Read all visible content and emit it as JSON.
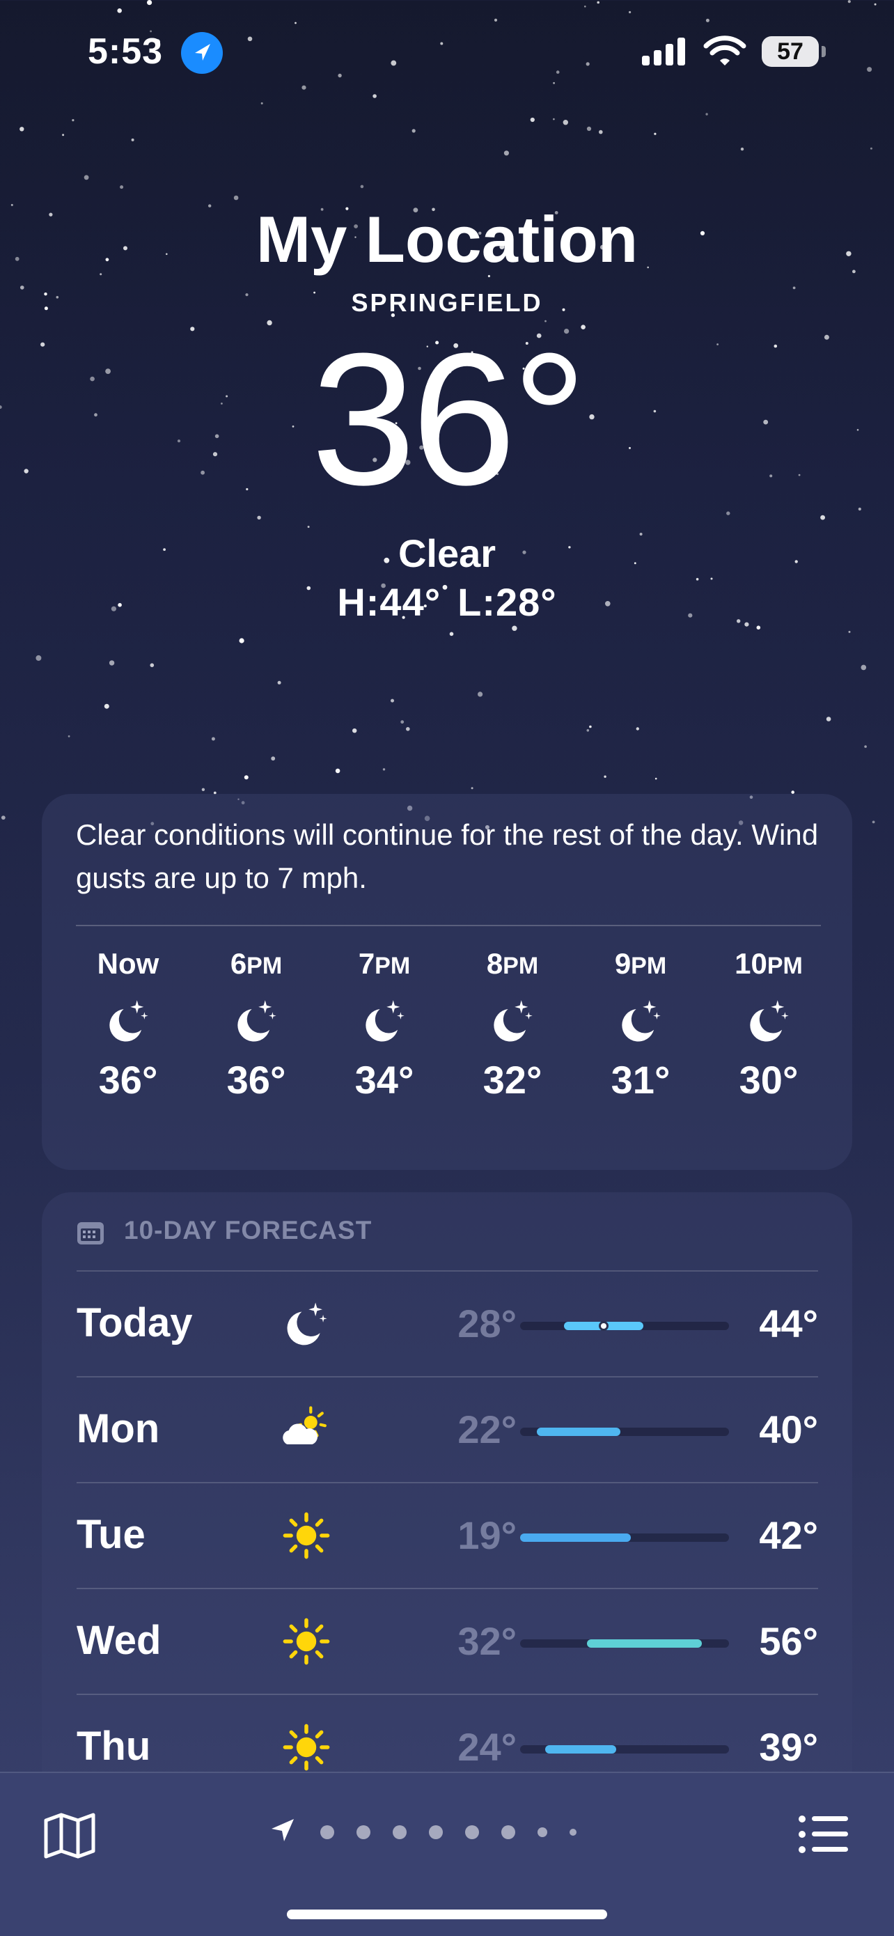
{
  "status_bar": {
    "time": "5:53",
    "battery": "57"
  },
  "header": {
    "title": "My Location",
    "subtitle": "SPRINGFIELD",
    "temperature": "36°",
    "condition": "Clear",
    "high": "H:44°",
    "low": "L:28°"
  },
  "hourly": {
    "summary": "Clear conditions will continue for the rest of the day. Wind gusts are up to 7 mph.",
    "items": [
      {
        "num": "Now",
        "unit": "",
        "icon": "moon-stars-icon",
        "temp": "36°"
      },
      {
        "num": "6",
        "unit": "PM",
        "icon": "moon-stars-icon",
        "temp": "36°"
      },
      {
        "num": "7",
        "unit": "PM",
        "icon": "moon-stars-icon",
        "temp": "34°"
      },
      {
        "num": "8",
        "unit": "PM",
        "icon": "moon-stars-icon",
        "temp": "32°"
      },
      {
        "num": "9",
        "unit": "PM",
        "icon": "moon-stars-icon",
        "temp": "31°"
      },
      {
        "num": "10",
        "unit": "PM",
        "icon": "moon-stars-icon",
        "temp": "30°"
      }
    ]
  },
  "forecast": {
    "header": "10-DAY FORECAST",
    "days": [
      {
        "day": "Today",
        "icon": "moon-stars-icon",
        "low": "28°",
        "high": "44°",
        "bar_start": 0.21,
        "bar_end": 0.59,
        "current": 0.4,
        "bar_color": "#5ac8fa"
      },
      {
        "day": "Mon",
        "icon": "cloud-sun-icon",
        "low": "22°",
        "high": "40°",
        "bar_start": 0.08,
        "bar_end": 0.48,
        "bar_color": "#4fb6f0"
      },
      {
        "day": "Tue",
        "icon": "sun-icon",
        "low": "19°",
        "high": "42°",
        "bar_start": 0.0,
        "bar_end": 0.53,
        "bar_color": "#4aaaf0"
      },
      {
        "day": "Wed",
        "icon": "sun-icon",
        "low": "32°",
        "high": "56°",
        "bar_start": 0.32,
        "bar_end": 0.87,
        "bar_color": "#5ed0d6"
      },
      {
        "day": "Thu",
        "icon": "sun-icon",
        "low": "24°",
        "high": "39°",
        "bar_start": 0.12,
        "bar_end": 0.46,
        "bar_color": "#4fb6f0"
      }
    ]
  },
  "tabbar": {
    "map_icon": "map-icon",
    "list_icon": "list-icon",
    "page_dots": 9
  },
  "colors": {
    "accent_blue": "#1a8cff",
    "sun_yellow": "#ffd60a"
  }
}
